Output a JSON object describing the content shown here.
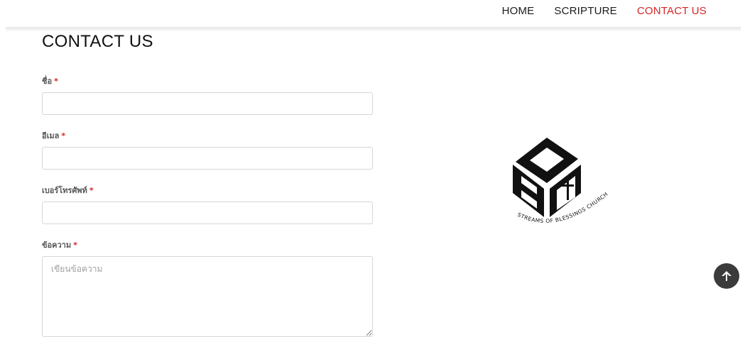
{
  "nav": {
    "items": [
      {
        "label": "HOME"
      },
      {
        "label": "SCRIPTURE"
      },
      {
        "label": "CONTACT US",
        "active": true
      }
    ],
    "active_color": "#d72323"
  },
  "page": {
    "title": "CONTACT US"
  },
  "form": {
    "required_mark": "*",
    "fields": [
      {
        "label": "ชื่อ",
        "value": ""
      },
      {
        "label": "อีเมล",
        "value": ""
      },
      {
        "label": "เบอร์โทรศัพท์",
        "value": ""
      },
      {
        "label": "ข้อความ",
        "placeholder": "เขียนข้อความ",
        "value": ""
      }
    ]
  },
  "logo": {
    "text": "STREAMS OF BLESSINGS CHURCH"
  },
  "scroll_top": {
    "icon": "arrow-up-icon"
  }
}
